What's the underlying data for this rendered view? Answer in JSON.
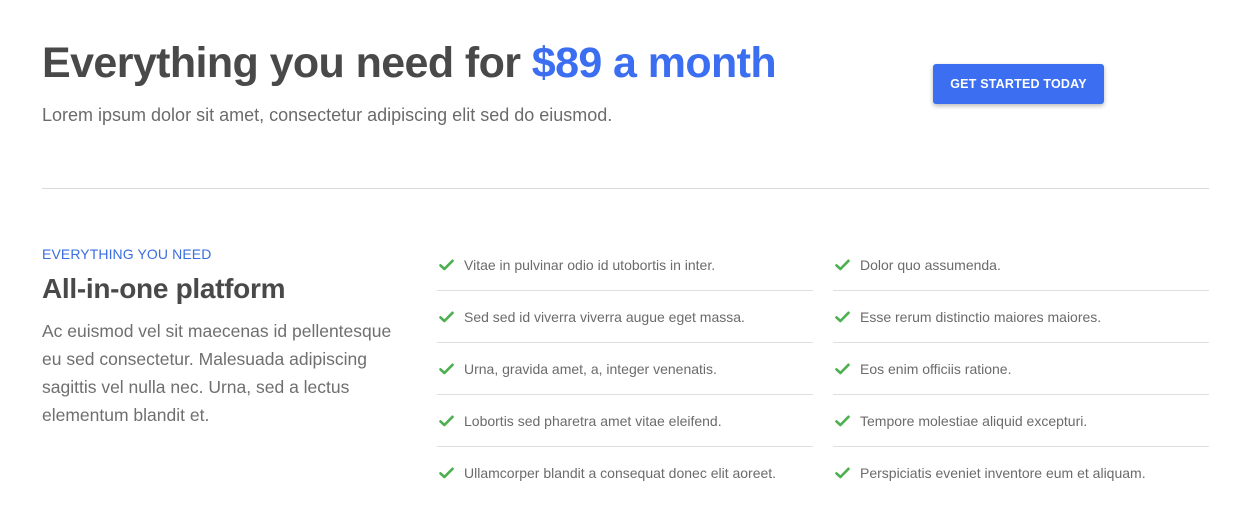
{
  "hero": {
    "headline_main": "Everything you need for ",
    "headline_price": "$89 a month",
    "subtitle": "Lorem ipsum dolor sit amet, consectetur adipiscing elit sed do eiusmod.",
    "cta_label": "GET STARTED TODAY"
  },
  "section": {
    "eyebrow": "EVERYTHING YOU NEED",
    "title": "All-in-one platform",
    "body": "Ac euismod vel sit maecenas id pellentesque eu sed consectetur. Malesuada adipiscing sagittis vel nulla nec. Urna, sed a lectus elementum blandit et."
  },
  "features": {
    "icon": "check-icon",
    "check_color": "#4caf50",
    "left": [
      "Vitae in pulvinar odio id utobortis in inter.",
      "Sed sed id viverra viverra augue eget massa.",
      "Urna, gravida amet, a, integer venenatis.",
      "Lobortis sed pharetra amet vitae eleifend.",
      "Ullamcorper blandit a consequat donec elit aoreet."
    ],
    "right": [
      "Dolor quo assumenda.",
      "Esse rerum distinctio maiores maiores.",
      "Eos enim officiis ratione.",
      "Tempore molestiae aliquid excepturi.",
      "Perspiciatis eveniet inventore eum et aliquam."
    ]
  },
  "colors": {
    "accent": "#3b6ef0",
    "heading": "#494949",
    "text": "#6b6b6b"
  }
}
